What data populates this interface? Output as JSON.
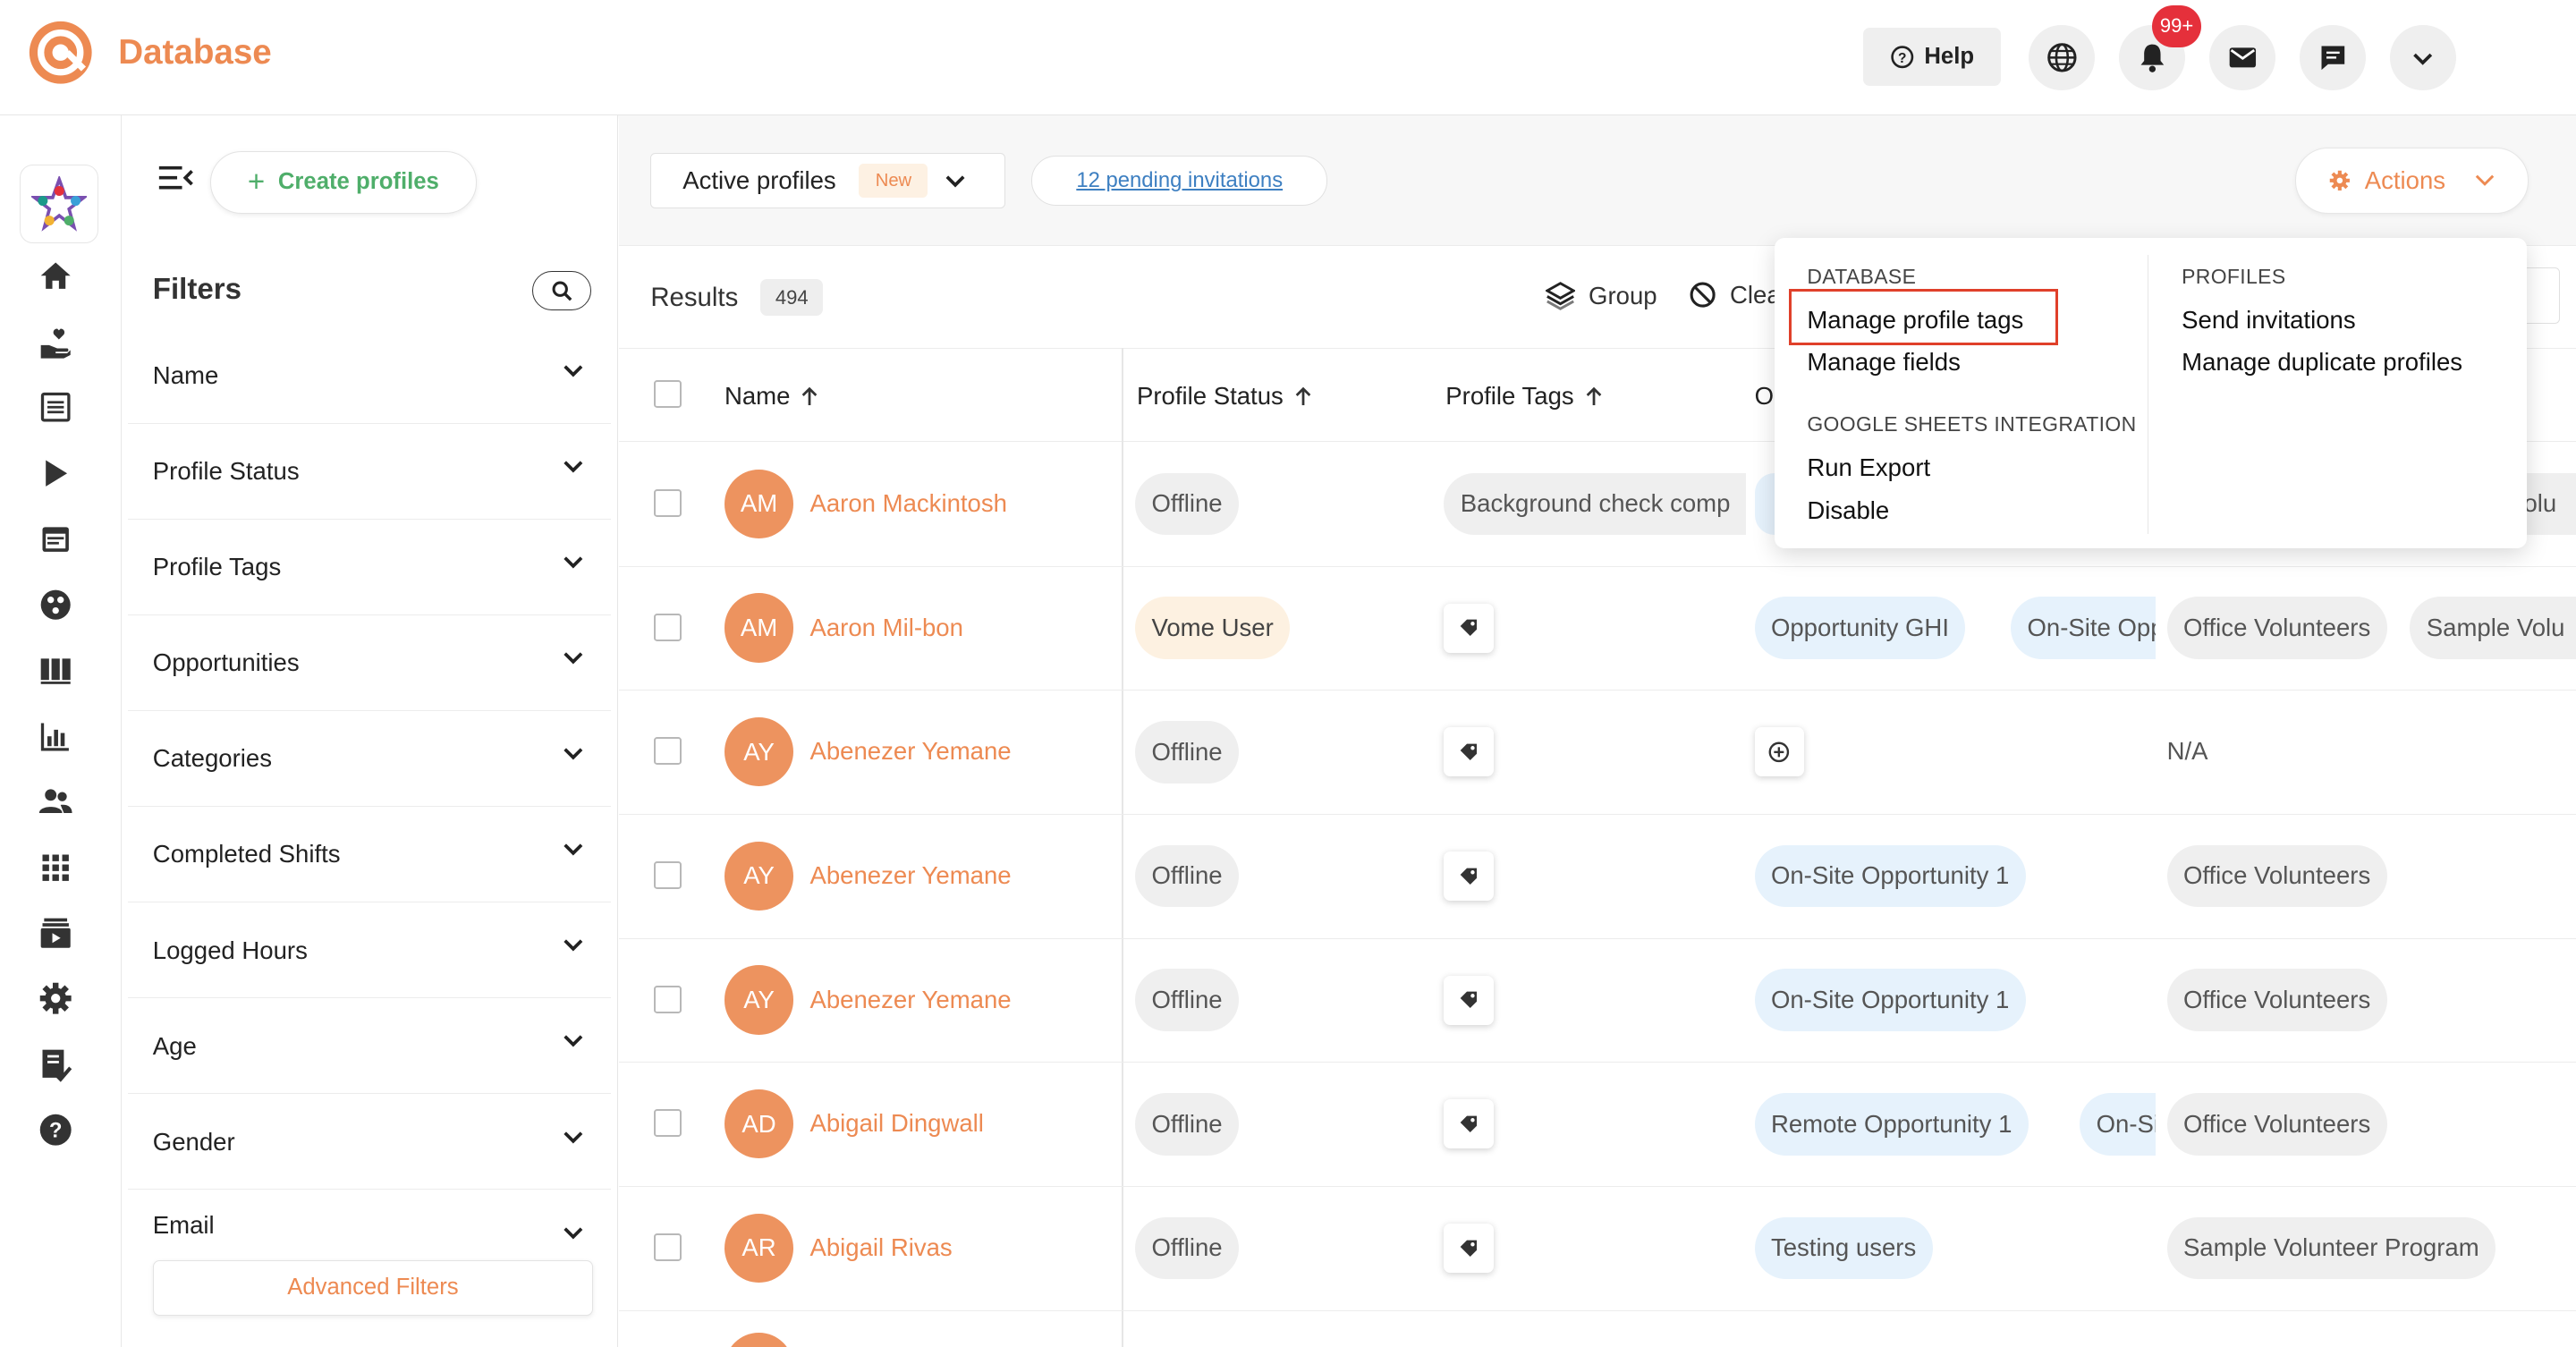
{
  "app": {
    "title": "Database"
  },
  "header": {
    "help_label": "Help",
    "notification_count": "99+"
  },
  "toolbar": {
    "create_label": "Create profiles",
    "filters_title": "Filters",
    "advanced_filters_label": "Advanced Filters",
    "active_profiles_label": "Active profiles",
    "new_tag": "New",
    "pending_invitations": "12 pending invitations",
    "actions_label": "Actions",
    "results_label": "Results",
    "results_count": "494",
    "group_label": "Group",
    "clear_label": "Clea"
  },
  "filters": [
    "Name",
    "Profile Status",
    "Profile Tags",
    "Opportunities",
    "Categories",
    "Completed Shifts",
    "Logged Hours",
    "Age",
    "Gender",
    "Email"
  ],
  "table": {
    "columns": [
      "Name",
      "Profile Status",
      "Profile Tags",
      "O"
    ],
    "rows": [
      {
        "initials": "AM",
        "name": "Aaron Mackintosh",
        "status": "Offline",
        "status_style": "gray",
        "tag_text": "Background check comp",
        "opps": [],
        "cat": "",
        "cat2": "Volu"
      },
      {
        "initials": "AM",
        "name": "Aaron Mil-bon",
        "status": "Vome User",
        "status_style": "cream",
        "tag_text": "",
        "opps": [
          "Opportunity GHI",
          "On-Site Oppo"
        ],
        "cat": "Office Volunteers",
        "cat2": "Sample Volu"
      },
      {
        "initials": "AY",
        "name": "Abenezer Yemane",
        "status": "Offline",
        "status_style": "gray",
        "tag_text": "",
        "opps": [],
        "cat": "N/A",
        "cat2": ""
      },
      {
        "initials": "AY",
        "name": "Abenezer Yemane",
        "status": "Offline",
        "status_style": "gray",
        "tag_text": "",
        "opps": [
          "On-Site Opportunity 1"
        ],
        "cat": "Office Volunteers",
        "cat2": ""
      },
      {
        "initials": "AY",
        "name": "Abenezer Yemane",
        "status": "Offline",
        "status_style": "gray",
        "tag_text": "",
        "opps": [
          "On-Site Opportunity 1"
        ],
        "cat": "Office Volunteers",
        "cat2": ""
      },
      {
        "initials": "AD",
        "name": "Abigail Dingwall",
        "status": "Offline",
        "status_style": "gray",
        "tag_text": "",
        "opps": [
          "Remote Opportunity 1",
          "On-Site"
        ],
        "cat": "Office Volunteers",
        "cat2": ""
      },
      {
        "initials": "AR",
        "name": "Abigail Rivas",
        "status": "Offline",
        "status_style": "gray",
        "tag_text": "",
        "opps": [
          "Testing users"
        ],
        "cat": "Sample Volunteer Program",
        "cat2": ""
      }
    ]
  },
  "menu": {
    "database_header": "DATABASE",
    "manage_tags": "Manage profile tags",
    "manage_fields": "Manage fields",
    "sheets_header": "GOOGLE SHEETS INTEGRATION",
    "run_export": "Run Export",
    "disable": "Disable",
    "profiles_header": "PROFILES",
    "send_invitations": "Send invitations",
    "manage_duplicates": "Manage duplicate profiles"
  },
  "colors": {
    "brand": "#ed8a52",
    "create_green": "#4fae6a",
    "link_blue": "#3d7fc1",
    "alert_red": "#e5303b",
    "highlight_red": "#e0402a"
  }
}
